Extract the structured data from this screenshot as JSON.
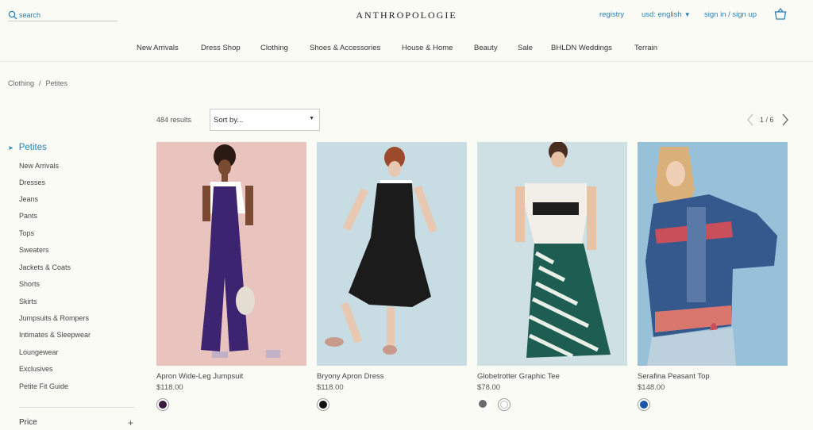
{
  "header": {
    "search_placeholder": "search",
    "logo": "ANTHROPOLOGIE",
    "registry": "registry",
    "currency": "usd: english",
    "signin": "sign in / sign up"
  },
  "nav": {
    "items": [
      "New Arrivals",
      "Dress Shop",
      "Clothing",
      "Shoes & Accessories",
      "House & Home",
      "Beauty",
      "Sale",
      "BHLDN Weddings",
      "Terrain"
    ]
  },
  "breadcrumb": [
    "Clothing",
    "Petites"
  ],
  "breadcrumb_sep": "/",
  "sidebar": {
    "title": "Petites",
    "items": [
      "New Arrivals",
      "Dresses",
      "Jeans",
      "Pants",
      "Tops",
      "Sweaters",
      "Jackets & Coats",
      "Shorts",
      "Skirts",
      "Jumpsuits & Rompers",
      "Intimates & Sleepwear",
      "Loungewear",
      "Exclusives",
      "Petite Fit Guide"
    ]
  },
  "filter": {
    "label": "Price",
    "toggle": "+"
  },
  "results": "484 results",
  "sort": {
    "label": "Sort by..."
  },
  "pager": {
    "text": "1 / 6"
  },
  "products": [
    {
      "name": "Apron Wide-Leg Jumpsuit",
      "price": "$118.00",
      "swatches": [
        "#3a1a3e"
      ]
    },
    {
      "name": "Bryony Apron Dress",
      "price": "$118.00",
      "swatches": [
        "#111111"
      ]
    },
    {
      "name": "Globetrotter Graphic Tee",
      "price": "$78.00",
      "swatches": [
        "#6b6b6b",
        "#ffffff"
      ]
    },
    {
      "name": "Serafina Peasant Top",
      "price": "$148.00",
      "swatches": [
        "#1b56a8"
      ]
    }
  ],
  "colors": {
    "accent": "#2a7fb0",
    "background": "#fbfbf6"
  }
}
